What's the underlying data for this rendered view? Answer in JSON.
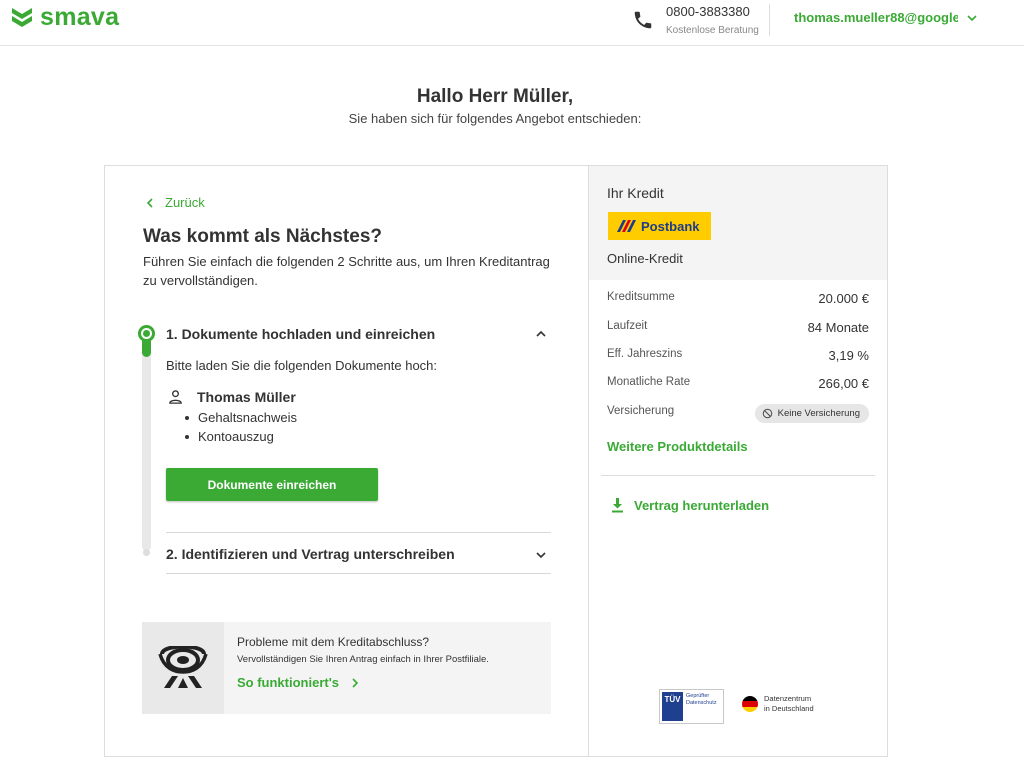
{
  "header": {
    "logo_text": "smava",
    "phone_number": "0800-3883380",
    "phone_sub": "Kostenlose Beratung",
    "account_email": "thomas.mueller88@google..."
  },
  "greeting": {
    "title": "Hallo Herr Müller,",
    "subtitle": "Sie haben sich für folgendes Angebot entschieden:"
  },
  "steps_panel": {
    "back_label": "Zurück",
    "title": "Was kommt als Nächstes?",
    "description": "Führen Sie einfach die folgenden 2 Schritte aus, um Ihren Kreditantrag zu vervollständigen.",
    "step1": {
      "title": "1. Dokumente hochladen und einreichen",
      "instruction": "Bitte laden Sie die folgenden Dokumente hoch:",
      "person_name": "Thomas Müller",
      "documents": [
        "Gehaltsnachweis",
        "Kontoauszug"
      ],
      "button_label": "Dokumente einreichen"
    },
    "step2": {
      "title": "2. Identifizieren und Vertrag unterschreiben"
    },
    "post": {
      "title": "Probleme mit dem Kreditabschluss?",
      "subtitle": "Vervollständigen Sie Ihren Antrag einfach in Ihrer Postfiliale.",
      "link_label": "So funktioniert's"
    }
  },
  "credit": {
    "title": "Ihr Kredit",
    "bank_name": "Postbank",
    "product": "Online-Kredit",
    "details": [
      {
        "label": "Kreditsumme",
        "value": "20.000 €"
      },
      {
        "label": "Laufzeit",
        "value": "84 Monate"
      },
      {
        "label": "Eff. Jahreszins",
        "value": "3,19 %"
      },
      {
        "label": "Monatliche Rate",
        "value": "266,00 €"
      }
    ],
    "insurance_label": "Versicherung",
    "insurance_value": "Keine Versicherung",
    "more_details_label": "Weitere Produktdetails",
    "download_label": "Vertrag herunterladen",
    "tuev_mark": "TÜV",
    "tuev_text": "Geprüfter Datenschutz",
    "dz_line1": "Datenzentrum",
    "dz_line2": "in Deutschland"
  },
  "colors": {
    "accent": "#3aaa35",
    "bank_yellow": "#ffcc00",
    "bank_blue": "#1e3c8c"
  }
}
